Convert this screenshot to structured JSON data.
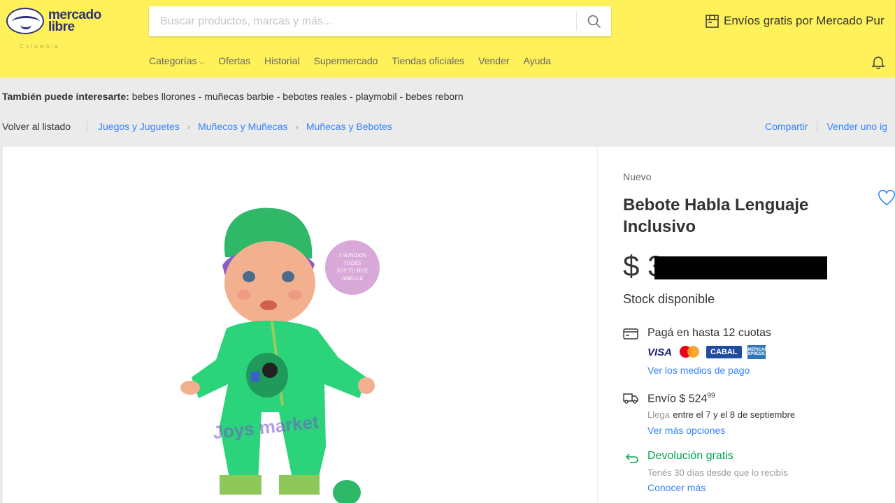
{
  "header": {
    "logo_line1": "mercado",
    "logo_line2": "libre",
    "logo_sub": "Colombia",
    "search_placeholder": "Buscar productos, marcas y más...",
    "promo": "Envíos gratis por Mercado Pur",
    "nav": [
      "Categorías",
      "Ofertas",
      "Historial",
      "Supermercado",
      "Tiendas oficiales",
      "Vender",
      "Ayuda"
    ]
  },
  "related": {
    "label": "También puede interesarte:",
    "items": "bebes llorones - muñecas barbie - bebotes reales - playmobil - bebes reborn"
  },
  "breadcrumb": {
    "back": "Volver al listado",
    "items": [
      "Juegos y Juguetes",
      "Muñecos y Muñecas",
      "Muñecas y Bebotes"
    ],
    "share": "Compartir",
    "sell": "Vender uno ig"
  },
  "product": {
    "condition": "Nuevo",
    "title": "Bebote Habla Lenguaje Inclusivo",
    "price_symbol": "$ 3",
    "stock": "Stock disponible",
    "badge_lines": [
      "3 SONIDOS",
      "TODES",
      "SOY TU HIJE",
      "AMIGUE"
    ],
    "watermark": "Joys market"
  },
  "payment": {
    "title": "Pagá en hasta 12 cuotas",
    "cards": [
      "VISA",
      "CABAL",
      "AMERICAN EXPRESS"
    ],
    "link": "Ver los medios de pago"
  },
  "shipping": {
    "title": "Envío $ 524",
    "cents": "99",
    "arrives_prefix": "Llega",
    "arrives": "entre el 7 y el 8 de septiembre",
    "link": "Ver más opciones"
  },
  "returns": {
    "title": "Devolución gratis",
    "detail": "Tenés 30 días desde que lo recibís",
    "link": "Conocer más"
  },
  "colors": {
    "header_bg": "#fff159",
    "link": "#3483fa",
    "green": "#00a650",
    "page_bg": "#ebebeb"
  }
}
